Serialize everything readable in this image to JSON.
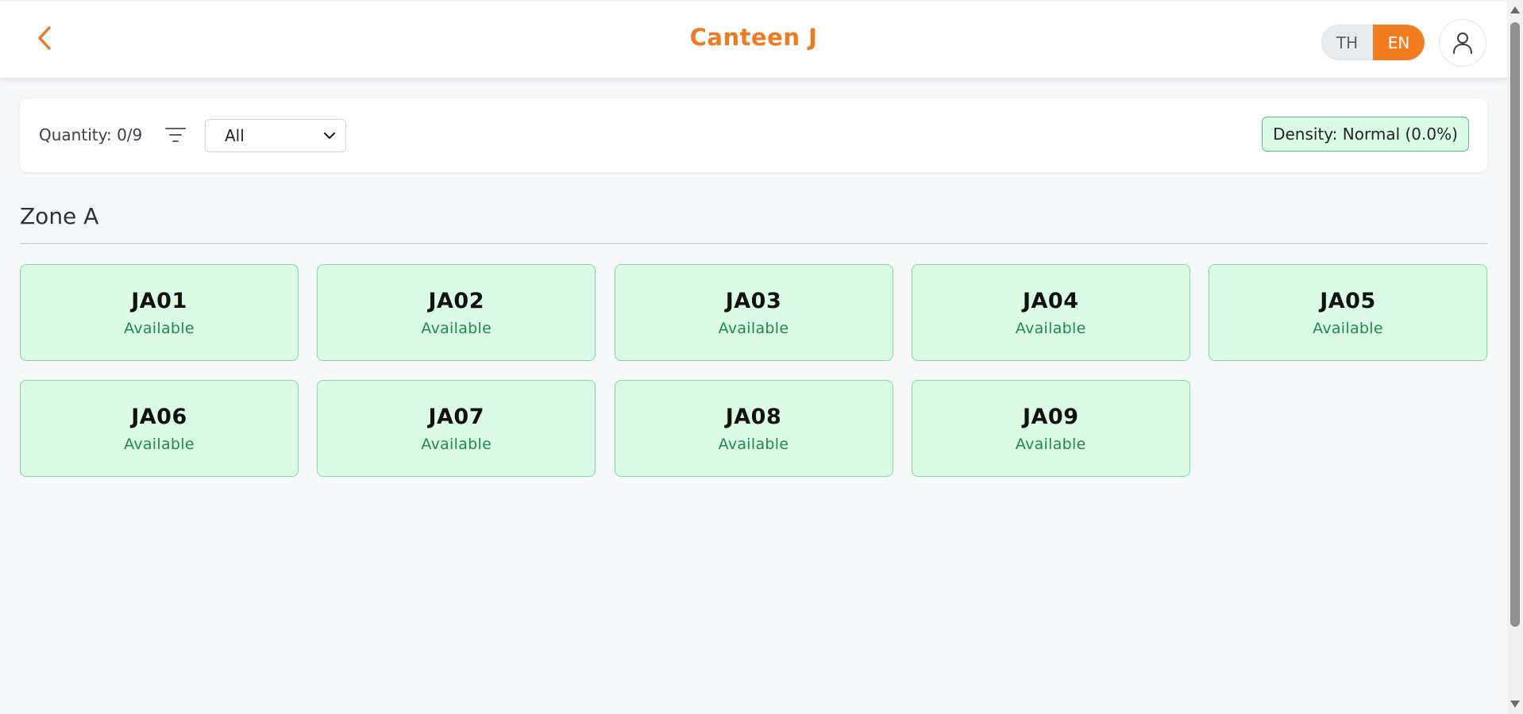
{
  "header": {
    "title": "Canteen J",
    "back_icon": "chevron-left-icon",
    "languages": [
      {
        "label": "TH",
        "active": false
      },
      {
        "label": "EN",
        "active": true
      }
    ],
    "profile_icon": "user-icon"
  },
  "toolbar": {
    "quantity_label": "Quantity: 0/9",
    "filter_icon": "filter-icon",
    "select_value": "All",
    "density_label": "Density: Normal (0.0%)"
  },
  "zone": {
    "title": "Zone A",
    "seats": [
      {
        "code": "JA01",
        "status": "Available"
      },
      {
        "code": "JA02",
        "status": "Available"
      },
      {
        "code": "JA03",
        "status": "Available"
      },
      {
        "code": "JA04",
        "status": "Available"
      },
      {
        "code": "JA05",
        "status": "Available"
      },
      {
        "code": "JA06",
        "status": "Available"
      },
      {
        "code": "JA07",
        "status": "Available"
      },
      {
        "code": "JA08",
        "status": "Available"
      },
      {
        "code": "JA09",
        "status": "Available"
      }
    ]
  },
  "colors": {
    "accent": "#f47c20",
    "available_bg": "#dcfbe6",
    "available_border": "#7fdca0",
    "available_text": "#1f8a4c"
  }
}
